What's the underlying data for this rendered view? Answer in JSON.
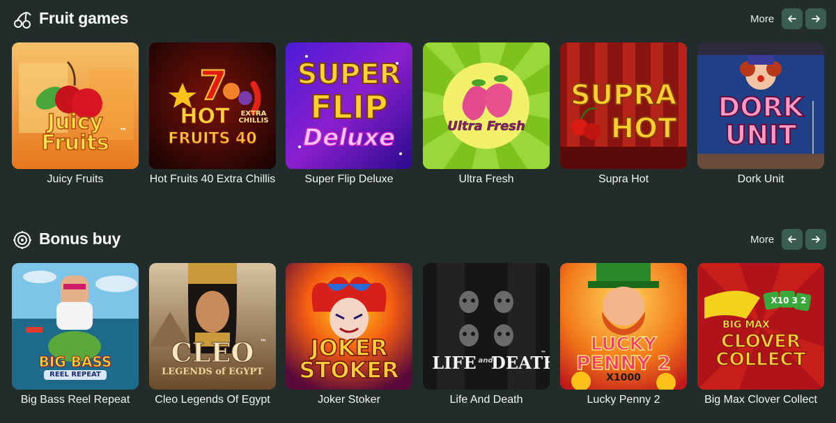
{
  "sections": [
    {
      "title": "Fruit games",
      "icon": "cherry-icon",
      "more_label": "More",
      "prev_icon": "arrow-left-icon",
      "next_icon": "arrow-right-icon",
      "games": [
        {
          "name": "Juicy Fruits",
          "logo": [
            "Juicy",
            "Fruits"
          ],
          "logo_mark": "™"
        },
        {
          "name": "Hot Fruits 40 Extra Chillis",
          "logo": [
            "HOT",
            "FRUITS 40"
          ],
          "logo_sub": "EXTRA CHILLIS"
        },
        {
          "name": "Super Flip Deluxe",
          "logo": [
            "SUPER",
            "FLIP",
            "Deluxe"
          ]
        },
        {
          "name": "Ultra Fresh",
          "logo": [
            "Ultra Fresh"
          ]
        },
        {
          "name": "Supra Hot",
          "logo": [
            "SUPRA",
            "HOT"
          ]
        },
        {
          "name": "Dork Unit",
          "logo": [
            "DORK",
            "UNIT"
          ]
        }
      ]
    },
    {
      "title": "Bonus buy",
      "icon": "target-icon",
      "more_label": "More",
      "prev_icon": "arrow-left-icon",
      "next_icon": "arrow-right-icon",
      "games": [
        {
          "name": "Big Bass Reel Repeat",
          "logo": [
            "BIG BASS",
            "REEL REPEAT"
          ]
        },
        {
          "name": "Cleo Legends Of Egypt",
          "logo": [
            "CLEO",
            "LEGENDS of EGYPT"
          ],
          "logo_mark": "™"
        },
        {
          "name": "Joker Stoker",
          "logo": [
            "JOKER",
            "STOKER"
          ]
        },
        {
          "name": "Life And Death",
          "logo": [
            "LIFE",
            "and",
            "DEATH"
          ],
          "logo_mark": "™"
        },
        {
          "name": "Lucky Penny 2",
          "logo": [
            "LUCKY",
            "PENNY 2",
            "X1000"
          ]
        },
        {
          "name": "Big Max Clover Collect",
          "logo": [
            "BIG MAX",
            "CLOVER",
            "COLLECT",
            "X10 3 2"
          ]
        }
      ]
    }
  ]
}
